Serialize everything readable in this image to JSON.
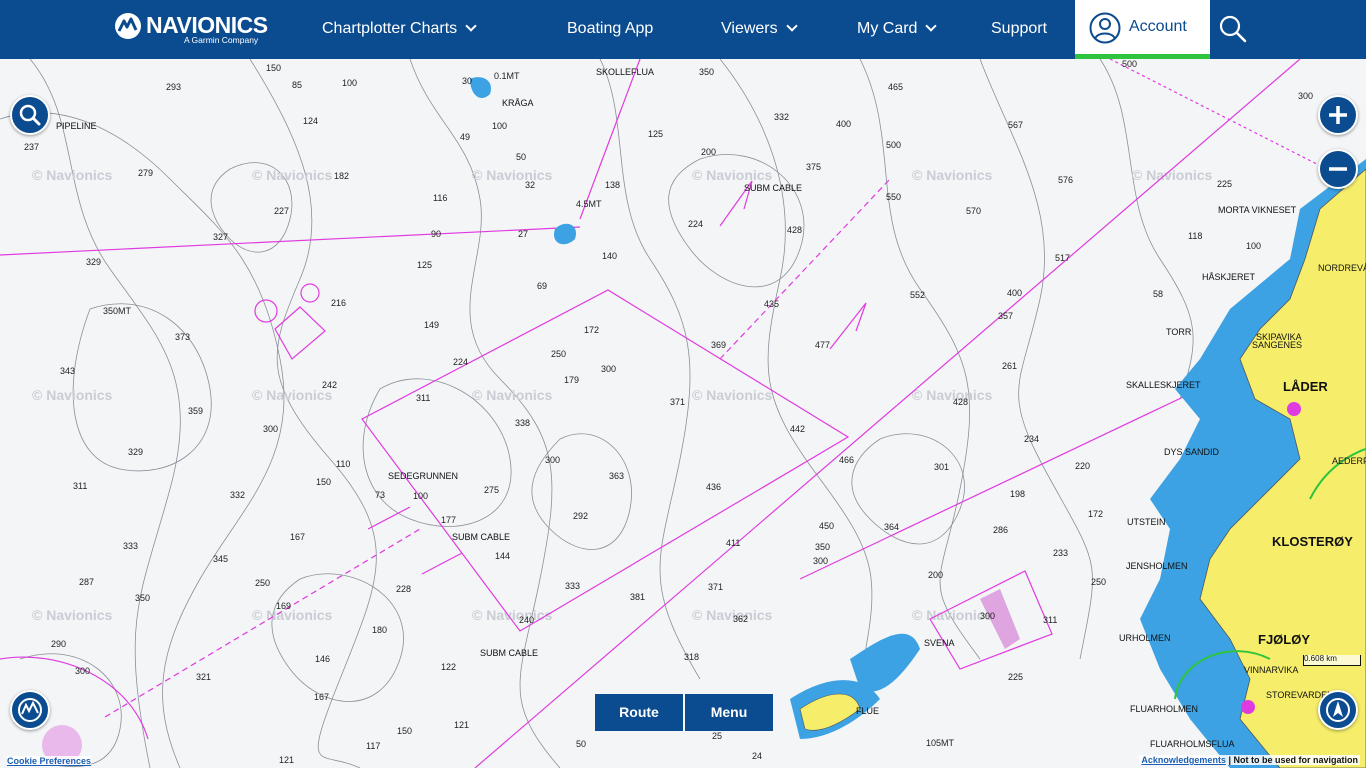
{
  "brand": {
    "name": "NAVIONICS",
    "tagline": "A Garmin Company"
  },
  "nav": {
    "items": [
      {
        "label": "Chartplotter Charts",
        "dropdown": true
      },
      {
        "label": "Boating App",
        "dropdown": false
      },
      {
        "label": "Viewers",
        "dropdown": true
      },
      {
        "label": "My Card",
        "dropdown": true
      },
      {
        "label": "Support",
        "dropdown": false
      }
    ],
    "account": "Account"
  },
  "controls": {
    "route": "Route",
    "menu": "Menu"
  },
  "footer": {
    "cookie": "Cookie Preferences",
    "acknowledgements": "Acknowledgements",
    "disclaimer": "| Not to be used for navigation"
  },
  "scale": {
    "value": "0.608",
    "unit": "km"
  },
  "watermark": "© Navionics",
  "map_labels": {
    "places": [
      "PIPELINE",
      "SKOLLEFLUA",
      "KRÅGA",
      "SUBM CABLE",
      "SEDEGRUNNEN",
      "SUBM CABLE",
      "SUBM CABLE",
      "MORTA VIKNESET",
      "HÅSKJERET",
      "NORDREVÅ",
      "SKIPAVIKA",
      "SANGENES",
      "LÅDER",
      "SKALLESKJERET",
      "TORR",
      "DYS SANDID",
      "UTSTEIN",
      "JENSHOLMEN",
      "KLOSTERØY",
      "URHOLMEN",
      "FJØLØY",
      "VINNARVIKA",
      "STOREVARDEN",
      "FLUARHOLMEN",
      "FLUARHOLMSFLUA",
      "SVENA",
      "AEDERFLU",
      "FLUE"
    ],
    "depth_samples": [
      "293",
      "150",
      "85",
      "100",
      "30",
      "0.1MT",
      "350",
      "465",
      "500",
      "300",
      "237",
      "124",
      "49",
      "100",
      "125",
      "332",
      "400",
      "567",
      "279",
      "182",
      "50",
      "32",
      "200",
      "375",
      "500",
      "576",
      "227",
      "116",
      "138",
      "4.5MT",
      "550",
      "570",
      "225",
      "327",
      "90",
      "27",
      "224",
      "428",
      "118",
      "329",
      "125",
      "140",
      "100",
      "517",
      "552",
      "400",
      "58",
      "350MT",
      "216",
      "69",
      "172",
      "435",
      "357",
      "373",
      "149",
      "250",
      "369",
      "477",
      "343",
      "224",
      "179",
      "300",
      "261",
      "242",
      "311",
      "371",
      "428",
      "359",
      "338",
      "442",
      "300",
      "363",
      "466",
      "301",
      "234",
      "220",
      "329",
      "110",
      "300",
      "436",
      "311",
      "150",
      "100",
      "275",
      "292",
      "364",
      "198",
      "172",
      "332",
      "73",
      "177",
      "144",
      "411",
      "450",
      "286",
      "233",
      "333",
      "167",
      "350",
      "345",
      "250",
      "300",
      "287",
      "228",
      "333",
      "371",
      "200",
      "250",
      "350",
      "169",
      "381",
      "362",
      "311",
      "290",
      "180",
      "240",
      "318",
      "300",
      "225",
      "300",
      "146",
      "122",
      "321",
      "167",
      "121",
      "150",
      "117",
      "121",
      "50",
      "25",
      "24",
      "105MT"
    ]
  }
}
